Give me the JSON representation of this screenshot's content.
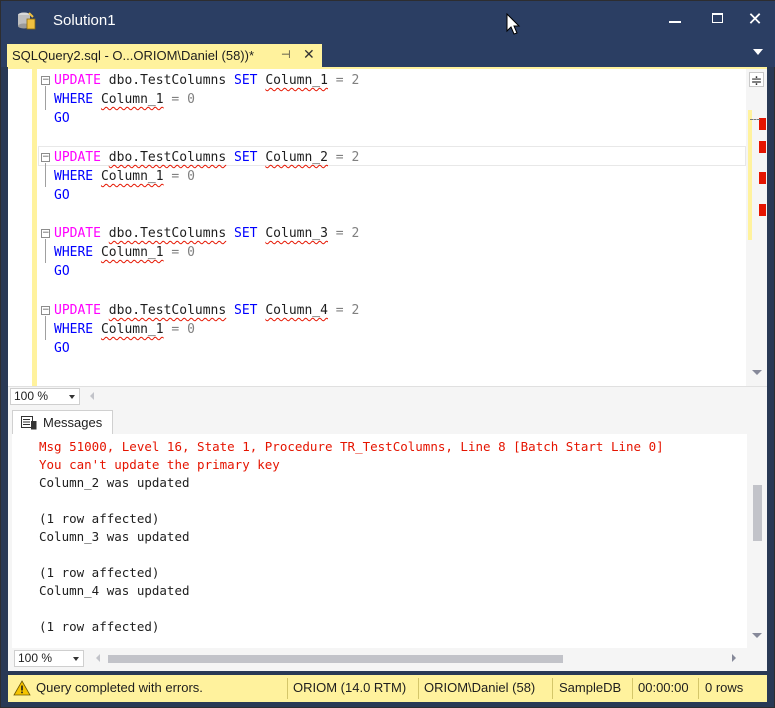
{
  "window": {
    "title": "Solution1",
    "min_label": "",
    "close_label": "✕"
  },
  "tab": {
    "label": "SQLQuery2.sql - O...ORIOM\\Daniel (58))*",
    "pin": "⊣",
    "close": "✕"
  },
  "editor": {
    "blocks": [
      {
        "update": "UPDATE",
        "table": "dbo.TestColumns",
        "set": "SET",
        "column": "Column_1",
        "eq": " = 2",
        "where": "WHERE",
        "where_col": "Column_1",
        "where_eq": " = 0",
        "go": "GO"
      },
      {
        "update": "UPDATE",
        "table": "dbo.TestColumns",
        "set": "SET",
        "column": "Column_2",
        "eq": " = 2",
        "where": "WHERE",
        "where_col": "Column_1",
        "where_eq": " = 0",
        "go": "GO"
      },
      {
        "update": "UPDATE",
        "table": "dbo.TestColumns",
        "set": "SET",
        "column": "Column_3",
        "eq": " = 2",
        "where": "WHERE",
        "where_col": "Column_1",
        "where_eq": " = 0",
        "go": "GO"
      },
      {
        "update": "UPDATE",
        "table": "dbo.TestColumns",
        "set": "SET",
        "column": "Column_4",
        "eq": " = 2",
        "where": "WHERE",
        "where_col": "Column_1",
        "where_eq": " = 0",
        "go": "GO"
      }
    ],
    "zoom": "100 %"
  },
  "messages": {
    "tab_label": "Messages",
    "lines": [
      {
        "text": "Msg 51000, Level 16, State 1, Procedure TR_TestColumns, Line 8 [Batch Start Line 0]",
        "error": true
      },
      {
        "text": "You can't update the primary key",
        "error": true
      },
      {
        "text": "Column_2 was updated",
        "error": false
      },
      {
        "text": "",
        "error": false
      },
      {
        "text": "(1 row affected)",
        "error": false
      },
      {
        "text": "Column_3 was updated",
        "error": false
      },
      {
        "text": "",
        "error": false
      },
      {
        "text": "(1 row affected)",
        "error": false
      },
      {
        "text": "Column_4 was updated",
        "error": false
      },
      {
        "text": "",
        "error": false
      },
      {
        "text": "(1 row affected)",
        "error": false
      }
    ],
    "zoom": "100 %"
  },
  "status": {
    "message": "Query completed with errors.",
    "server": "ORIOM (14.0 RTM)",
    "user": "ORIOM\\Daniel (58)",
    "database": "SampleDB",
    "elapsed": "00:00:00",
    "rows": "0 rows"
  },
  "colors": {
    "accent_yellow": "#fff29d",
    "title_bar": "#2b3e63",
    "error_red": "#e51400",
    "keyword_blue": "#0000ff",
    "keyword_pink": "#ff00ff"
  }
}
